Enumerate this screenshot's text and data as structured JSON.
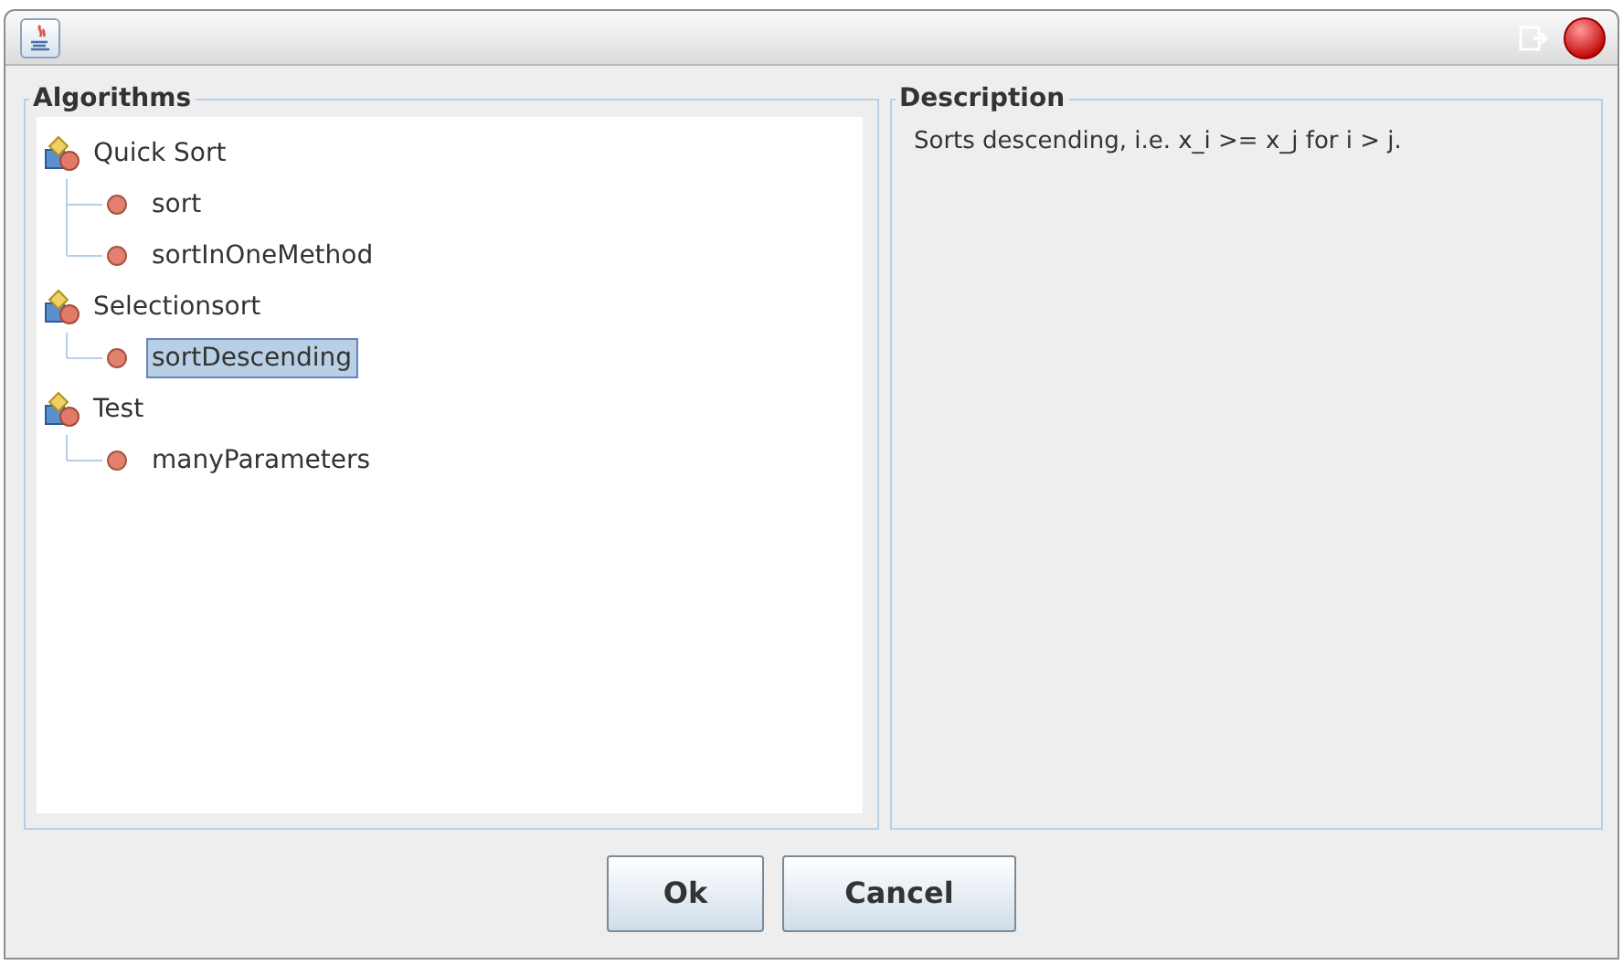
{
  "algorithms": {
    "title": "Algorithms",
    "tree": [
      {
        "label": "Quick Sort",
        "selected": false,
        "children": [
          {
            "label": "sort",
            "selected": false
          },
          {
            "label": "sortInOneMethod",
            "selected": false
          }
        ]
      },
      {
        "label": "Selectionsort",
        "selected": false,
        "children": [
          {
            "label": "sortDescending",
            "selected": true
          }
        ]
      },
      {
        "label": "Test",
        "selected": false,
        "children": [
          {
            "label": "manyParameters",
            "selected": false
          }
        ]
      }
    ]
  },
  "description": {
    "title": "Description",
    "text": "Sorts descending, i.e. x_i >= x_j for i > j."
  },
  "buttons": [
    "Ok",
    "Cancel"
  ]
}
